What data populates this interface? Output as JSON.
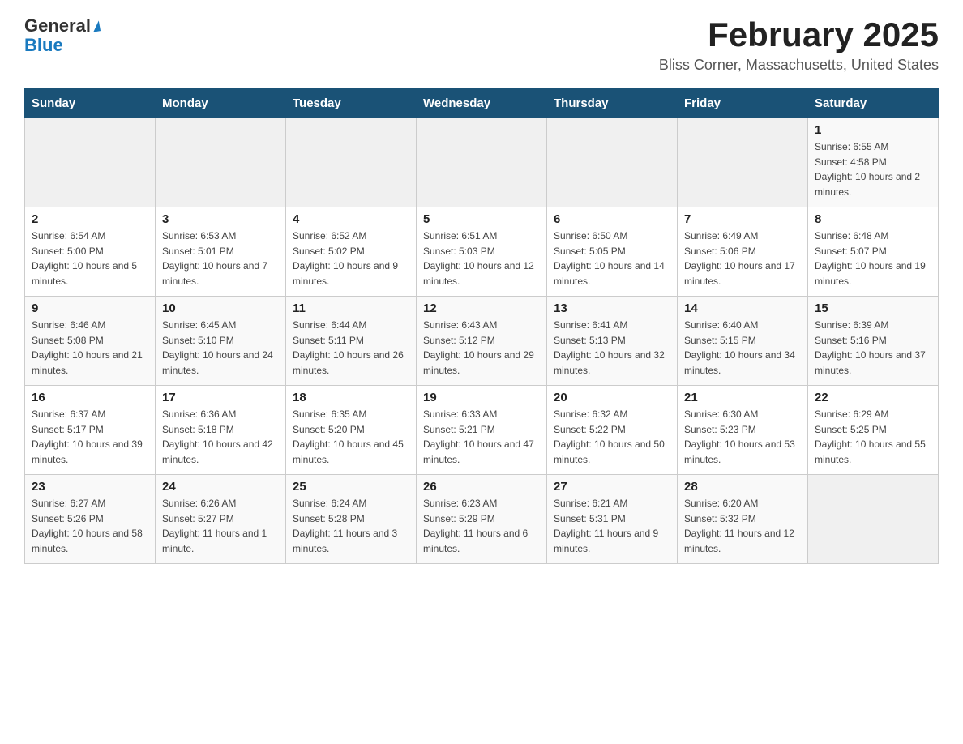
{
  "logo": {
    "text_general": "General",
    "logo_arrow": "▲",
    "text_blue": "Blue"
  },
  "header": {
    "title": "February 2025",
    "subtitle": "Bliss Corner, Massachusetts, United States"
  },
  "days_of_week": [
    "Sunday",
    "Monday",
    "Tuesday",
    "Wednesday",
    "Thursday",
    "Friday",
    "Saturday"
  ],
  "weeks": [
    [
      {
        "day": "",
        "info": ""
      },
      {
        "day": "",
        "info": ""
      },
      {
        "day": "",
        "info": ""
      },
      {
        "day": "",
        "info": ""
      },
      {
        "day": "",
        "info": ""
      },
      {
        "day": "",
        "info": ""
      },
      {
        "day": "1",
        "info": "Sunrise: 6:55 AM\nSunset: 4:58 PM\nDaylight: 10 hours and 2 minutes."
      }
    ],
    [
      {
        "day": "2",
        "info": "Sunrise: 6:54 AM\nSunset: 5:00 PM\nDaylight: 10 hours and 5 minutes."
      },
      {
        "day": "3",
        "info": "Sunrise: 6:53 AM\nSunset: 5:01 PM\nDaylight: 10 hours and 7 minutes."
      },
      {
        "day": "4",
        "info": "Sunrise: 6:52 AM\nSunset: 5:02 PM\nDaylight: 10 hours and 9 minutes."
      },
      {
        "day": "5",
        "info": "Sunrise: 6:51 AM\nSunset: 5:03 PM\nDaylight: 10 hours and 12 minutes."
      },
      {
        "day": "6",
        "info": "Sunrise: 6:50 AM\nSunset: 5:05 PM\nDaylight: 10 hours and 14 minutes."
      },
      {
        "day": "7",
        "info": "Sunrise: 6:49 AM\nSunset: 5:06 PM\nDaylight: 10 hours and 17 minutes."
      },
      {
        "day": "8",
        "info": "Sunrise: 6:48 AM\nSunset: 5:07 PM\nDaylight: 10 hours and 19 minutes."
      }
    ],
    [
      {
        "day": "9",
        "info": "Sunrise: 6:46 AM\nSunset: 5:08 PM\nDaylight: 10 hours and 21 minutes."
      },
      {
        "day": "10",
        "info": "Sunrise: 6:45 AM\nSunset: 5:10 PM\nDaylight: 10 hours and 24 minutes."
      },
      {
        "day": "11",
        "info": "Sunrise: 6:44 AM\nSunset: 5:11 PM\nDaylight: 10 hours and 26 minutes."
      },
      {
        "day": "12",
        "info": "Sunrise: 6:43 AM\nSunset: 5:12 PM\nDaylight: 10 hours and 29 minutes."
      },
      {
        "day": "13",
        "info": "Sunrise: 6:41 AM\nSunset: 5:13 PM\nDaylight: 10 hours and 32 minutes."
      },
      {
        "day": "14",
        "info": "Sunrise: 6:40 AM\nSunset: 5:15 PM\nDaylight: 10 hours and 34 minutes."
      },
      {
        "day": "15",
        "info": "Sunrise: 6:39 AM\nSunset: 5:16 PM\nDaylight: 10 hours and 37 minutes."
      }
    ],
    [
      {
        "day": "16",
        "info": "Sunrise: 6:37 AM\nSunset: 5:17 PM\nDaylight: 10 hours and 39 minutes."
      },
      {
        "day": "17",
        "info": "Sunrise: 6:36 AM\nSunset: 5:18 PM\nDaylight: 10 hours and 42 minutes."
      },
      {
        "day": "18",
        "info": "Sunrise: 6:35 AM\nSunset: 5:20 PM\nDaylight: 10 hours and 45 minutes."
      },
      {
        "day": "19",
        "info": "Sunrise: 6:33 AM\nSunset: 5:21 PM\nDaylight: 10 hours and 47 minutes."
      },
      {
        "day": "20",
        "info": "Sunrise: 6:32 AM\nSunset: 5:22 PM\nDaylight: 10 hours and 50 minutes."
      },
      {
        "day": "21",
        "info": "Sunrise: 6:30 AM\nSunset: 5:23 PM\nDaylight: 10 hours and 53 minutes."
      },
      {
        "day": "22",
        "info": "Sunrise: 6:29 AM\nSunset: 5:25 PM\nDaylight: 10 hours and 55 minutes."
      }
    ],
    [
      {
        "day": "23",
        "info": "Sunrise: 6:27 AM\nSunset: 5:26 PM\nDaylight: 10 hours and 58 minutes."
      },
      {
        "day": "24",
        "info": "Sunrise: 6:26 AM\nSunset: 5:27 PM\nDaylight: 11 hours and 1 minute."
      },
      {
        "day": "25",
        "info": "Sunrise: 6:24 AM\nSunset: 5:28 PM\nDaylight: 11 hours and 3 minutes."
      },
      {
        "day": "26",
        "info": "Sunrise: 6:23 AM\nSunset: 5:29 PM\nDaylight: 11 hours and 6 minutes."
      },
      {
        "day": "27",
        "info": "Sunrise: 6:21 AM\nSunset: 5:31 PM\nDaylight: 11 hours and 9 minutes."
      },
      {
        "day": "28",
        "info": "Sunrise: 6:20 AM\nSunset: 5:32 PM\nDaylight: 11 hours and 12 minutes."
      },
      {
        "day": "",
        "info": ""
      }
    ]
  ]
}
